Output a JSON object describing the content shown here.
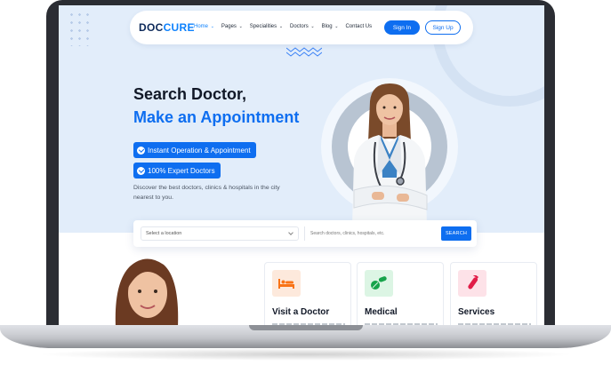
{
  "brand": {
    "logo_text": "DOCCURE",
    "logo_main": "DOC",
    "logo_accent": "CURE"
  },
  "nav": {
    "links": [
      {
        "label": "Home",
        "caret": "⌄",
        "active": true
      },
      {
        "label": "Pages",
        "caret": "⌄"
      },
      {
        "label": "Specialities",
        "caret": "⌄"
      },
      {
        "label": "Doctors",
        "caret": "⌄"
      },
      {
        "label": "Blog",
        "caret": "⌄"
      },
      {
        "label": "Contact Us",
        "caret": ""
      }
    ],
    "sign_in": "Sign In",
    "sign_up": "Sign Up"
  },
  "hero": {
    "title_line1": "Search Doctor,",
    "title_line2": "Make an Appointment",
    "badges": [
      "Instant Operation & Appointment",
      "100% Expert Doctors"
    ],
    "description": "Discover the best doctors, clinics & hospitals in the city nearest to you."
  },
  "search": {
    "location_placeholder": "Select a location",
    "query_placeholder": "Search doctors, clinics, hospitals, etc.",
    "button_label": "SEARCH"
  },
  "services": [
    {
      "title": "Visit a Doctor",
      "icon": "bed-icon",
      "color": "#f97316"
    },
    {
      "title": "Medical",
      "icon": "pills-icon",
      "color": "#16a34a"
    },
    {
      "title": "Services",
      "icon": "test-tube-icon",
      "color": "#e11d48"
    }
  ],
  "colors": {
    "primary": "#0e6ef0",
    "hero_bg": "#e2edfa",
    "dark_text": "#111827"
  }
}
